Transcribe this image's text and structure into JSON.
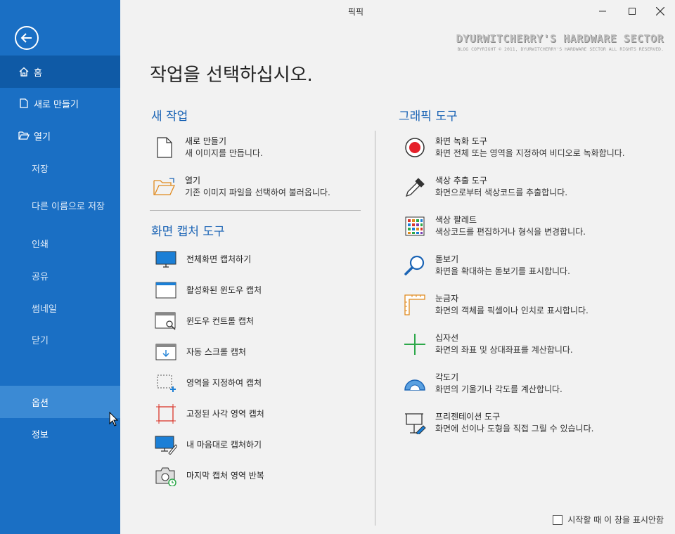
{
  "window": {
    "title": "픽픽"
  },
  "watermark": {
    "line1": "DYURWITCHERRY'S HARDWARE SECTOR",
    "line2": "BLOG COPYRIGHT © 2011, DYURWITCHERRY'S HARDWARE SECTOR ALL RIGHTS RESERVED."
  },
  "sidebar": {
    "items": [
      {
        "label": "홈",
        "icon": "home-icon"
      },
      {
        "label": "새로 만들기",
        "icon": "file-icon"
      },
      {
        "label": "열기",
        "icon": "folder-open-icon"
      },
      {
        "label": "저장"
      },
      {
        "label": "다른 이름으로 저장"
      },
      {
        "label": "인쇄"
      },
      {
        "label": "공유"
      },
      {
        "label": "썸네일"
      },
      {
        "label": "닫기"
      },
      {
        "label": "옵션"
      },
      {
        "label": "정보"
      }
    ]
  },
  "main": {
    "title": "작업을 선택하십시오.",
    "new_task": {
      "heading": "새 작업",
      "items": [
        {
          "title": "새로 만들기",
          "desc": "새 이미지를 만듭니다."
        },
        {
          "title": "열기",
          "desc": "기존 이미지 파일을 선택하여 불러옵니다."
        }
      ]
    },
    "capture": {
      "heading": "화면 캡처 도구",
      "items": [
        {
          "title": "전체화면 캡처하기"
        },
        {
          "title": "활성화된 윈도우 캡처"
        },
        {
          "title": "윈도우 컨트롤 캡처"
        },
        {
          "title": "자동 스크롤 캡처"
        },
        {
          "title": "영역을 지정하여 캡처"
        },
        {
          "title": "고정된 사각 영역 캡처"
        },
        {
          "title": "내 마음대로 캡처하기"
        },
        {
          "title": "마지막 캡처 영역 반복"
        }
      ]
    },
    "graphics": {
      "heading": "그래픽 도구",
      "items": [
        {
          "title": "화면 녹화 도구",
          "desc": "화면 전체 또는 영역을 지정하여 비디오로 녹화합니다."
        },
        {
          "title": "색상 추출 도구",
          "desc": "화면으로부터 색상코드를 추출합니다."
        },
        {
          "title": "색상 팔레트",
          "desc": "색상코드를 편집하거나 형식을 변경합니다."
        },
        {
          "title": "돋보기",
          "desc": "화면을 확대하는 돋보기를 표시합니다."
        },
        {
          "title": "눈금자",
          "desc": "화면의 객체를 픽셀이나 인치로 표시합니다."
        },
        {
          "title": "십자선",
          "desc": "화면의 좌표 및 상대좌표를 계산합니다."
        },
        {
          "title": "각도기",
          "desc": "화면의 기울기나 각도를 계산합니다."
        },
        {
          "title": "프리젠테이션 도구",
          "desc": "화면에 선이나 도형을 직접 그릴 수 있습니다."
        }
      ]
    },
    "dont_show_label": "시작할 때 이 창을 표시안함"
  },
  "colors": {
    "sidebar": "#1a6fc4",
    "sidebar_active": "#0f5aa6",
    "sidebar_hover": "#3b8ad4",
    "heading": "#1b64b5"
  }
}
